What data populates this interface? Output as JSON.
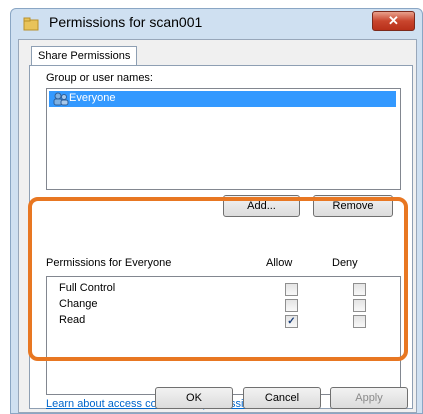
{
  "window": {
    "title": "Permissions for scan001",
    "close_label": "✕"
  },
  "tabs": [
    {
      "label": "Share Permissions"
    }
  ],
  "group": {
    "label": "Group or user names:",
    "users": [
      {
        "name": "Everyone",
        "selected": true
      }
    ],
    "add_label": "Add...",
    "remove_label": "Remove"
  },
  "permissions": {
    "title": "Permissions for Everyone",
    "allow_header": "Allow",
    "deny_header": "Deny",
    "rows": [
      {
        "name": "Full Control",
        "allow": false,
        "deny": false
      },
      {
        "name": "Change",
        "allow": false,
        "deny": false
      },
      {
        "name": "Read",
        "allow": true,
        "deny": false
      }
    ]
  },
  "help_link": "Learn about access control and permissions",
  "buttons": {
    "ok": "OK",
    "cancel": "Cancel",
    "apply": "Apply"
  },
  "colors": {
    "highlight": "#e87722",
    "selection": "#3399ff",
    "link": "#0066cc"
  }
}
